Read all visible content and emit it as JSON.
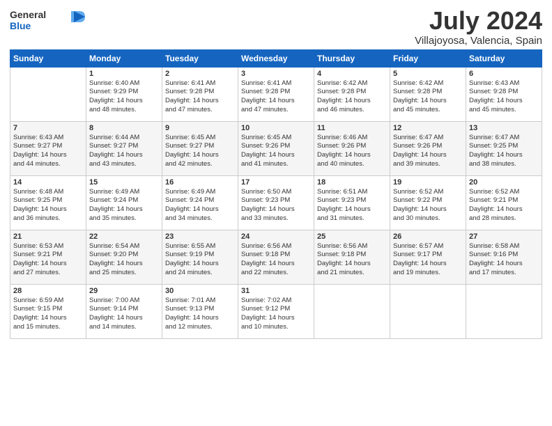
{
  "header": {
    "logo_general": "General",
    "logo_blue": "Blue",
    "month": "July 2024",
    "location": "Villajoyosa, Valencia, Spain"
  },
  "days_of_week": [
    "Sunday",
    "Monday",
    "Tuesday",
    "Wednesday",
    "Thursday",
    "Friday",
    "Saturday"
  ],
  "weeks": [
    [
      {
        "day": "",
        "content": ""
      },
      {
        "day": "1",
        "content": "Sunrise: 6:40 AM\nSunset: 9:29 PM\nDaylight: 14 hours\nand 48 minutes."
      },
      {
        "day": "2",
        "content": "Sunrise: 6:41 AM\nSunset: 9:28 PM\nDaylight: 14 hours\nand 47 minutes."
      },
      {
        "day": "3",
        "content": "Sunrise: 6:41 AM\nSunset: 9:28 PM\nDaylight: 14 hours\nand 47 minutes."
      },
      {
        "day": "4",
        "content": "Sunrise: 6:42 AM\nSunset: 9:28 PM\nDaylight: 14 hours\nand 46 minutes."
      },
      {
        "day": "5",
        "content": "Sunrise: 6:42 AM\nSunset: 9:28 PM\nDaylight: 14 hours\nand 45 minutes."
      },
      {
        "day": "6",
        "content": "Sunrise: 6:43 AM\nSunset: 9:28 PM\nDaylight: 14 hours\nand 45 minutes."
      }
    ],
    [
      {
        "day": "7",
        "content": "Sunrise: 6:43 AM\nSunset: 9:27 PM\nDaylight: 14 hours\nand 44 minutes."
      },
      {
        "day": "8",
        "content": "Sunrise: 6:44 AM\nSunset: 9:27 PM\nDaylight: 14 hours\nand 43 minutes."
      },
      {
        "day": "9",
        "content": "Sunrise: 6:45 AM\nSunset: 9:27 PM\nDaylight: 14 hours\nand 42 minutes."
      },
      {
        "day": "10",
        "content": "Sunrise: 6:45 AM\nSunset: 9:26 PM\nDaylight: 14 hours\nand 41 minutes."
      },
      {
        "day": "11",
        "content": "Sunrise: 6:46 AM\nSunset: 9:26 PM\nDaylight: 14 hours\nand 40 minutes."
      },
      {
        "day": "12",
        "content": "Sunrise: 6:47 AM\nSunset: 9:26 PM\nDaylight: 14 hours\nand 39 minutes."
      },
      {
        "day": "13",
        "content": "Sunrise: 6:47 AM\nSunset: 9:25 PM\nDaylight: 14 hours\nand 38 minutes."
      }
    ],
    [
      {
        "day": "14",
        "content": "Sunrise: 6:48 AM\nSunset: 9:25 PM\nDaylight: 14 hours\nand 36 minutes."
      },
      {
        "day": "15",
        "content": "Sunrise: 6:49 AM\nSunset: 9:24 PM\nDaylight: 14 hours\nand 35 minutes."
      },
      {
        "day": "16",
        "content": "Sunrise: 6:49 AM\nSunset: 9:24 PM\nDaylight: 14 hours\nand 34 minutes."
      },
      {
        "day": "17",
        "content": "Sunrise: 6:50 AM\nSunset: 9:23 PM\nDaylight: 14 hours\nand 33 minutes."
      },
      {
        "day": "18",
        "content": "Sunrise: 6:51 AM\nSunset: 9:23 PM\nDaylight: 14 hours\nand 31 minutes."
      },
      {
        "day": "19",
        "content": "Sunrise: 6:52 AM\nSunset: 9:22 PM\nDaylight: 14 hours\nand 30 minutes."
      },
      {
        "day": "20",
        "content": "Sunrise: 6:52 AM\nSunset: 9:21 PM\nDaylight: 14 hours\nand 28 minutes."
      }
    ],
    [
      {
        "day": "21",
        "content": "Sunrise: 6:53 AM\nSunset: 9:21 PM\nDaylight: 14 hours\nand 27 minutes."
      },
      {
        "day": "22",
        "content": "Sunrise: 6:54 AM\nSunset: 9:20 PM\nDaylight: 14 hours\nand 25 minutes."
      },
      {
        "day": "23",
        "content": "Sunrise: 6:55 AM\nSunset: 9:19 PM\nDaylight: 14 hours\nand 24 minutes."
      },
      {
        "day": "24",
        "content": "Sunrise: 6:56 AM\nSunset: 9:18 PM\nDaylight: 14 hours\nand 22 minutes."
      },
      {
        "day": "25",
        "content": "Sunrise: 6:56 AM\nSunset: 9:18 PM\nDaylight: 14 hours\nand 21 minutes."
      },
      {
        "day": "26",
        "content": "Sunrise: 6:57 AM\nSunset: 9:17 PM\nDaylight: 14 hours\nand 19 minutes."
      },
      {
        "day": "27",
        "content": "Sunrise: 6:58 AM\nSunset: 9:16 PM\nDaylight: 14 hours\nand 17 minutes."
      }
    ],
    [
      {
        "day": "28",
        "content": "Sunrise: 6:59 AM\nSunset: 9:15 PM\nDaylight: 14 hours\nand 15 minutes."
      },
      {
        "day": "29",
        "content": "Sunrise: 7:00 AM\nSunset: 9:14 PM\nDaylight: 14 hours\nand 14 minutes."
      },
      {
        "day": "30",
        "content": "Sunrise: 7:01 AM\nSunset: 9:13 PM\nDaylight: 14 hours\nand 12 minutes."
      },
      {
        "day": "31",
        "content": "Sunrise: 7:02 AM\nSunset: 9:12 PM\nDaylight: 14 hours\nand 10 minutes."
      },
      {
        "day": "",
        "content": ""
      },
      {
        "day": "",
        "content": ""
      },
      {
        "day": "",
        "content": ""
      }
    ]
  ]
}
